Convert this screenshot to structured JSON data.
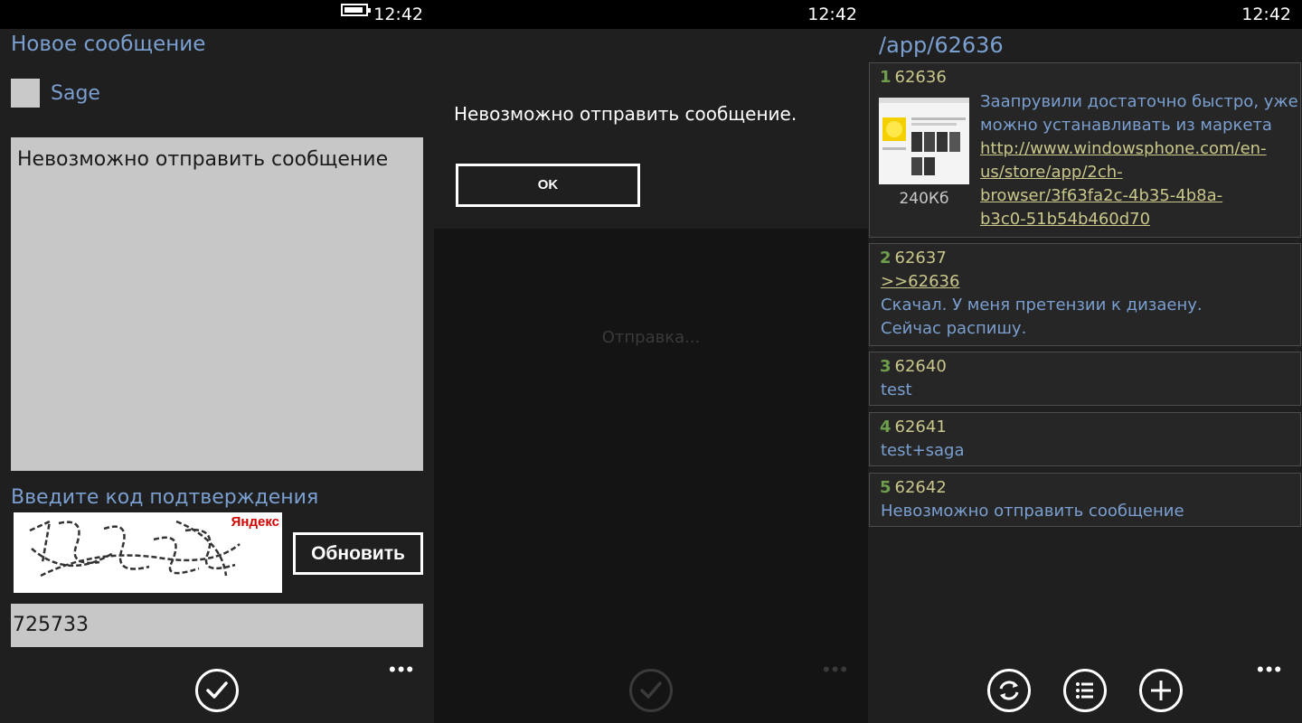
{
  "status": {
    "time": "12:42"
  },
  "compose": {
    "title": "Новое сообщение",
    "sage_label": "Sage",
    "message_text": "Невозможно отправить сообщение",
    "captcha_label": "Введите код подтверждения",
    "captcha_brand": "Яндекс",
    "refresh_label": "Обновить",
    "captcha_code": "725733",
    "send_icon": "check-icon",
    "more_label": "•••"
  },
  "dialog": {
    "message": "Невозможно отправить сообщение.",
    "ok_label": "OK",
    "sending_text": "Отправка...",
    "more_label": "•••"
  },
  "thread": {
    "title": "/app/62636",
    "more_label": "•••",
    "posts": [
      {
        "num": "1",
        "id": "62636",
        "text": "Заапрувили достаточно быстро, уже можно устанавливать из маркета",
        "link": "http://www.windowsphone.com/en-us/store/app/2ch-browser/3f63fa2c-4b35-4b8a-b3c0-51b54b460d70",
        "link_lines": [
          "http://www.windowsphone.com/en-",
          "us/store/app/2ch-",
          "browser/3f63fa2c-4b35-4b8a-",
          "b3c0-51b54b460d70"
        ],
        "text_lines": [
          "Заапрувили достаточно быстро, уже",
          "можно устанавливать из маркета"
        ],
        "image_size": "240Кб"
      },
      {
        "num": "2",
        "id": "62637",
        "reply": ">>62636",
        "text_lines": [
          "Скачал. У меня претензии к дизаену.",
          "Сейчас распишу."
        ]
      },
      {
        "num": "3",
        "id": "62640",
        "text": "test"
      },
      {
        "num": "4",
        "id": "62641",
        "text": "test+saga"
      },
      {
        "num": "5",
        "id": "62642",
        "text": "Невозможно отправить сообщение"
      }
    ],
    "appbar": [
      "refresh-icon",
      "list-icon",
      "add-icon"
    ]
  },
  "colors": {
    "accent_text": "#7a9fd0",
    "id_yellow": "#c9c78a",
    "num_green": "#6f9f4c"
  }
}
